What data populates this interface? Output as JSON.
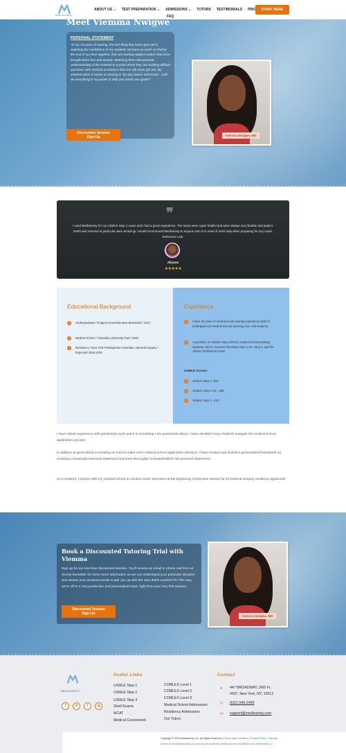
{
  "header": {
    "logo_text": "MEDLEARNITY",
    "nav": [
      "ABOUT US ⌄",
      "TEST PREPARATION ⌄",
      "ADMISSIONS ⌄",
      "TUTORS",
      "TESTIMONIALS",
      "PRICING"
    ],
    "nav_faq": "FAQ",
    "cta": "START HERE"
  },
  "hero": {
    "title": "Meet Viemma Nwigwe",
    "statement_heading": "PERSONAL STATEMENT",
    "statement": "“In my 10 years of tutoring, the one thing that never gets old is watching the confidence of my students increase so much so that by the end of our time together, they are owning subject matters that once brought them fear and anxiety. Watching them demonstrate understanding of the material to a point where they are tackling difficult questions with minimal assistance from me will never get old. My mindset when it comes to tutoring is “by any means necessary”. I will do everything in my power to help you reach your goals!”",
    "cta_line1": "Discounted Session",
    "cta_line2": "Sign-Up",
    "photo_name": "Viemma Nwigwe, MD"
  },
  "testimonial": {
    "quote_icon": "❞",
    "text": "I used Medlearnity for my USMLE Step 1 exam and I had a great experience. The tutors were super helpful and were always very flexible and patient. Smith and Viemma in particular were amazing! I would recommend Medlearnity to anyone who is in need of extra help when preparing for any exam. Reference Link.",
    "name": "Allyson",
    "stars": "★★★★★"
  },
  "education": {
    "title": "Educational Background",
    "items": [
      "Undergraduate / Rutgers University-New Brunswick / 2017",
      "Medical School / Columbia University P&S / 2021",
      "Residency / New York Presbyterian-Columbia, General Surgery / Expected 2026-2028"
    ]
  },
  "experience": {
    "title": "Experience",
    "items": [
      "I have 10 years of medical exam tutoring experience (both in undergrad and medical school) teaching over 100 students.",
      "I specialize in USMLE Step 1/2CK/3, Medical Sciences/Body Systems, MCAT, General Chemistry Step 2 CK, Step 3, and the ABSM Certification Exam."
    ],
    "scores_title": "USMLE Scores:",
    "scores": [
      "USMLE Step 1- 264",
      "USMLE Step 2 CK - 269",
      "USMLE Step 3 - 243"
    ]
  },
  "bio": [
    "I have robust experience with admissions work and it is something I am passionate about. I have assisted many students navigate the medical school application process.",
    "In addition to generalized counseling on how to make one's medical school application standout, I have created and shared a personalized framework on creating a meaningful personal statement and have thoroughly reviewed/edited >20 personal statements.",
    "As a resident, I partner with my medical school to conduct mock interviews at the beginning of interview season for its General Surgery residency applicants."
  ],
  "book": {
    "title": "Book a Discounted Tutoring Trial with Viemma",
    "text": "Sign up for our one-hour discounted session. You'll receive an email or phone call from us shortly thereafter for some more information so we can understand your particular situation and assess your personal needs to pair you up with the tutor that's a perfect fit. This way, we're off to a very productive and personalized start, right from your very first session.",
    "cta_line1": "Discounted Session",
    "cta_line2": "Sign-Up",
    "photo_name": "Viemma Nwigwe, MD"
  },
  "footer": {
    "logo_text": "MEDLEARNITY",
    "social": [
      "f",
      "in",
      "t",
      "ig"
    ],
    "useful_links_title": "Useful Links",
    "links_col1": [
      "USMLE Step 1",
      "USMLE Step 2",
      "USMLE Step 3",
      "Shelf Exams",
      "MCAT",
      "Medical Coursework"
    ],
    "links_col2": [
      "COMLEX Level 1",
      "COMLEX Level 2",
      "COMLEX Level 3",
      "Medical School Admissions",
      "Residency Admissions",
      "Our Tutors"
    ],
    "contact_title": "Contact",
    "address_line1": "447 BROADWAY, 2ND FL",
    "address_line2": "#507, New York, NY, 10013",
    "phone": "(631) 540-2499",
    "email": "support@medlearnity.com",
    "copyright": "Copyright © 2024 Medlearnity LLC. All Rights Reserved. |",
    "terms": " Terms and Conditions | Privacy Policy | Sitemap",
    "disclaimer": "Names of standardized tests are owned by the trademark holders and are not affiliated with Medlearnity LLC."
  },
  "colors": {
    "accent": "#e8730c",
    "hero_blue": "#5f98c4",
    "experience_blue": "#90c0eb",
    "education_bg": "#e9f1f9"
  }
}
